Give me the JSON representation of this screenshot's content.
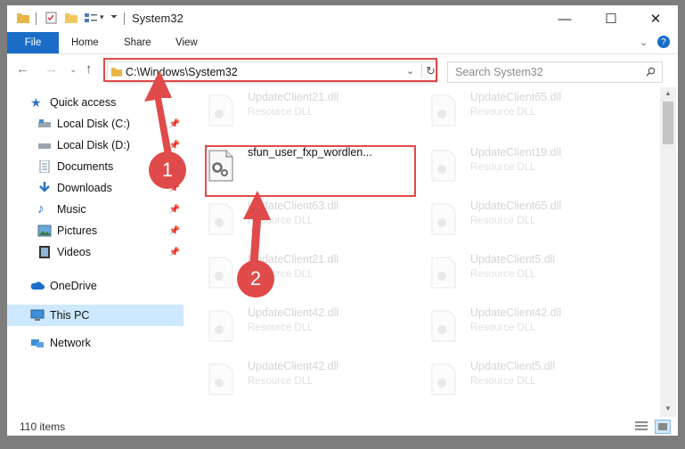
{
  "window": {
    "title": "System32",
    "minimize": "—",
    "maximize": "☐",
    "close": "✕"
  },
  "ribbon": {
    "file": "File",
    "home": "Home",
    "share": "Share",
    "view": "View"
  },
  "nav": {
    "address": "C:\\Windows\\System32",
    "search_placeholder": "Search System32"
  },
  "sidebar": {
    "quick_access": "Quick access",
    "items": [
      {
        "label": "Local Disk (C:)"
      },
      {
        "label": "Local Disk (D:)"
      },
      {
        "label": "Documents"
      },
      {
        "label": "Downloads"
      },
      {
        "label": "Music"
      },
      {
        "label": "Pictures"
      },
      {
        "label": "Videos"
      }
    ],
    "onedrive": "OneDrive",
    "this_pc": "This PC",
    "network": "Network"
  },
  "files": [
    {
      "name": "UpdateClient21.dll",
      "type": "Resource DLL"
    },
    {
      "name": "UpdateClient65.dll",
      "type": "Resource DLL"
    },
    {
      "name": "sfun_user_fxp_wordlen...",
      "type": ""
    },
    {
      "name": "UpdateClient19.dll",
      "type": "Resource DLL"
    },
    {
      "name": "UpdateClient63.dll",
      "type": "Resource DLL"
    },
    {
      "name": "UpdateClient65.dll",
      "type": "Resource DLL"
    },
    {
      "name": "UpdateClient21.dll",
      "type": "Resource DLL"
    },
    {
      "name": "UpdateClient5.dll",
      "type": "Resource DLL"
    },
    {
      "name": "UpdateClient42.dll",
      "type": "Resource DLL"
    },
    {
      "name": "UpdateClient42.dll",
      "type": "Resource DLL"
    },
    {
      "name": "UpdateClient42.dll",
      "type": "Resource DLL"
    },
    {
      "name": "UpdateClient5.dll",
      "type": "Resource DLL"
    }
  ],
  "status": {
    "items": "110 items"
  },
  "annotations": {
    "step1": "1",
    "step2": "2"
  }
}
